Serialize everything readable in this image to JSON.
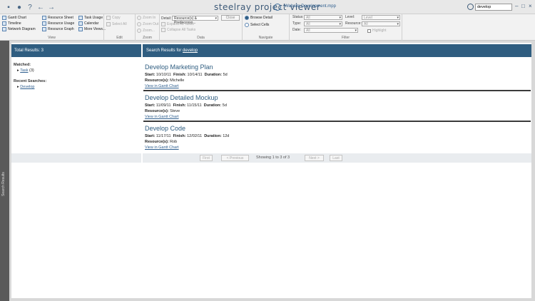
{
  "app": {
    "title": "steelray project viewer",
    "file_name": "Website Development.mpp",
    "search_value": "develop"
  },
  "ribbon": {
    "view": {
      "label": "View",
      "items": [
        "Gantt Chart",
        "Timeline",
        "Network Diagram",
        "Resource Sheet",
        "Resource Usage",
        "Resource Graph",
        "Task Usage",
        "Calendar",
        "More Views..."
      ]
    },
    "edit": {
      "label": "Edit",
      "items": [
        "Copy",
        "Select All"
      ]
    },
    "zoom": {
      "label": "Zoom",
      "items": [
        "Zoom In",
        "Zoom Out",
        "Zoom..."
      ]
    },
    "data": {
      "label": "Data",
      "detail_label": "Detail:",
      "detail_value": "Resource(s) & Predecesso...",
      "close": "Close",
      "expand": "Expand All Tasks",
      "collapse": "Collapse All Tasks"
    },
    "navigate": {
      "label": "Navigate",
      "browse": "Browse Detail",
      "select": "Select Cells"
    },
    "filter": {
      "label": "Filter",
      "status_label": "Status:",
      "status_value": "All",
      "type_label": "Type:",
      "type_value": "All",
      "date_label": "Date:",
      "date_value": "All",
      "level_label": "Level:",
      "level_value": "Level",
      "resource_label": "Resource:",
      "resource_value": "All",
      "highlight": "Highlight"
    }
  },
  "side_panel": {
    "label": "Search Results"
  },
  "left": {
    "header": "Total Results: 3",
    "matched_title": "Matched:",
    "matched_item": "Task",
    "matched_count": "(3)",
    "recent_title": "Recent Searches:",
    "recent_item": "Develop"
  },
  "right": {
    "header_prefix": "Search Results for",
    "header_term": "develop",
    "results": [
      {
        "title": "Develop Marketing Plan",
        "start": "10/10/11",
        "finish": "10/14/11",
        "duration": "5d",
        "resources": "Michelle",
        "link": "View in Gantt Chart"
      },
      {
        "title": "Develop Detailed Mockup",
        "start": "11/09/11",
        "finish": "11/15/11",
        "duration": "5d",
        "resources": "Steve",
        "link": "View in Gantt Chart"
      },
      {
        "title": "Develop Code",
        "start": "11/17/11",
        "finish": "12/02/11",
        "duration": "12d",
        "resources": "Rob",
        "link": "View in Gantt Chart"
      }
    ],
    "labels": {
      "start": "Start:",
      "finish": "Finish:",
      "duration": "Duration:",
      "resources": "Resource(s):"
    }
  },
  "pager": {
    "first": "First",
    "previous": "< Previous",
    "info": "Showing 1 to 3 of 3",
    "next": "Next >",
    "last": "Last"
  }
}
